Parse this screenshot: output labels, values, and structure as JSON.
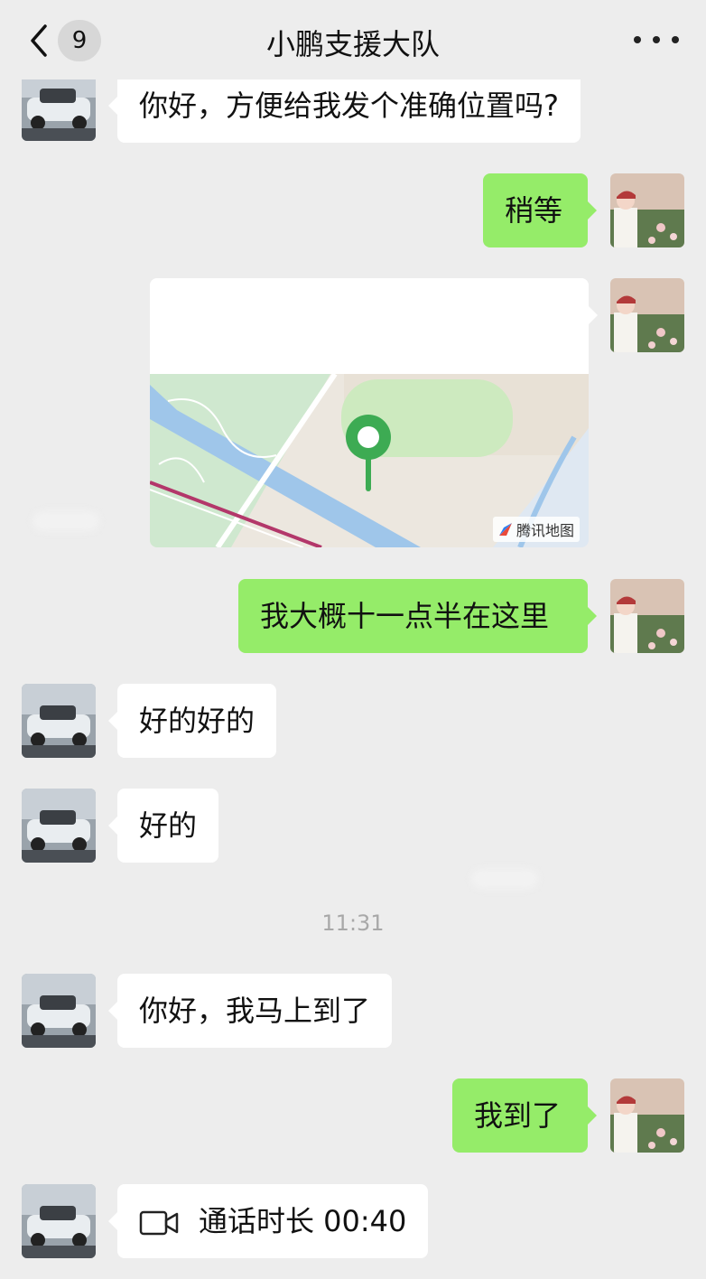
{
  "header": {
    "back_count": "9",
    "title": "小鹏支援大队"
  },
  "messages": {
    "m1": "你好，方便给我发个准确位置吗?",
    "m2": "稍等",
    "m4": "我大概十一点半在这里",
    "m5": "好的好的",
    "m6": "好的",
    "m7": "你好，我马上到了",
    "m8": "我到了",
    "m9_label": "通话时长 00:40"
  },
  "location_card": {
    "map_provider": "腾讯地图"
  },
  "timestamp": "11:31",
  "colors": {
    "background": "#ededed",
    "bubble_out": "#95ec69",
    "bubble_in": "#ffffff",
    "map_pin": "#3dab53"
  },
  "icons": [
    "back-chevron-icon",
    "more-icon",
    "video-call-icon",
    "map-pin-icon",
    "tencent-map-logo-icon"
  ]
}
